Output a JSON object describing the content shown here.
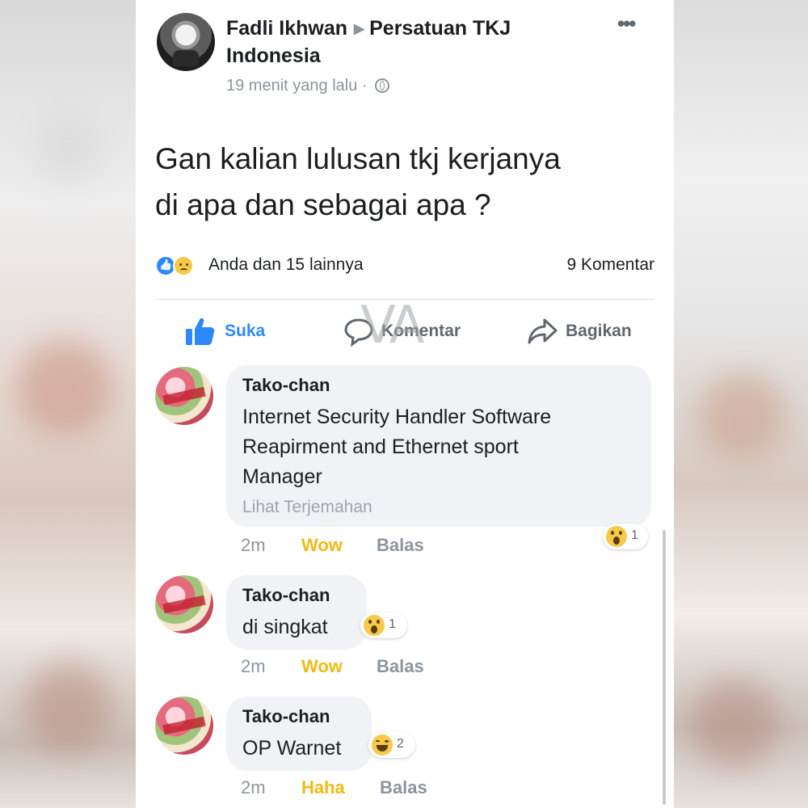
{
  "post": {
    "author": "Fadli Ikhwan",
    "group": "Persatuan TKJ Indonesia",
    "group_line1": "Persatuan TKJ",
    "group_line2": "Indonesia",
    "time": "19 menit yang lalu",
    "time_separator": "·",
    "text_line1": "Gan kalian lulusan tkj kerjanya",
    "text_line2": "di apa dan sebagai  apa ?",
    "reactions_text": "Anda dan 15 lainnya",
    "comment_count": "9 Komentar",
    "reaction_icons": [
      "like-icon",
      "sad-icon"
    ]
  },
  "actions": {
    "like": "Suka",
    "comment": "Komentar",
    "share": "Bagikan"
  },
  "watermark": "VA",
  "comments": [
    {
      "name": "Tako-chan",
      "text_lines": [
        "Internet Security Handler Software",
        "Reapirment and Ethernet sport",
        "Manager"
      ],
      "translate": "Lihat Terjemahan",
      "time": "2m",
      "my_reaction": "Wow",
      "reply": "Balas",
      "reaction_icon": "wow-icon",
      "reaction_count": "1"
    },
    {
      "name": "Tako-chan",
      "text_lines": [
        "di singkat"
      ],
      "time": "2m",
      "my_reaction": "Wow",
      "reply": "Balas",
      "reaction_icon": "wow-icon",
      "reaction_count": "1"
    },
    {
      "name": "Tako-chan",
      "text_lines": [
        "OP Warnet"
      ],
      "time": "2m",
      "my_reaction": "Haha",
      "reply": "Balas",
      "reaction_icon": "haha-icon",
      "reaction_count": "2"
    }
  ],
  "colors": {
    "accent": "#2d88ff",
    "reaction_text": "#f0ba15",
    "bubble": "#f0f2f5",
    "secondary_text": "#8d949e"
  }
}
